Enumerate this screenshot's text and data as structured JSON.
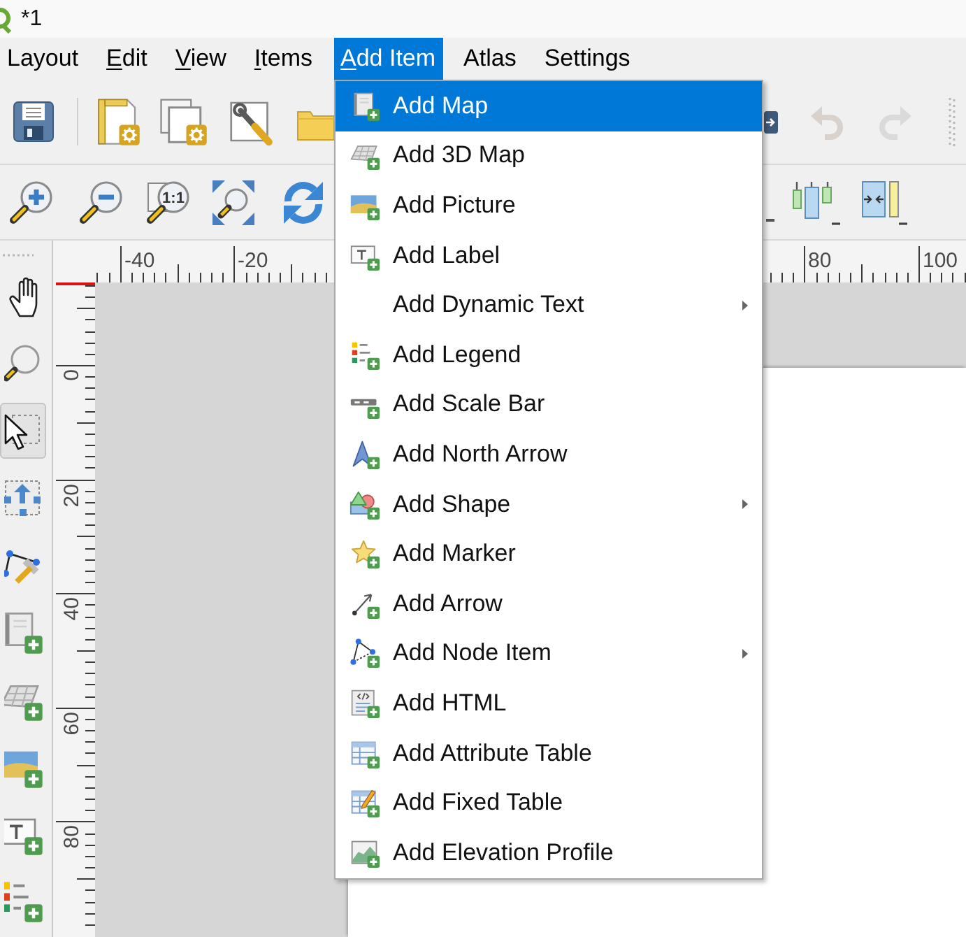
{
  "window": {
    "title": "*1"
  },
  "menu_bar": [
    {
      "label": "Layout",
      "selected": false,
      "mnemonic_underlined": false
    },
    {
      "label": "Edit",
      "selected": false,
      "mnemonic_underlined": true
    },
    {
      "label": "View",
      "selected": false,
      "mnemonic_underlined": true
    },
    {
      "label": "Items",
      "selected": false,
      "mnemonic_underlined": true
    },
    {
      "label": "Add Item",
      "selected": true,
      "mnemonic_underlined": true
    },
    {
      "label": "Atlas",
      "selected": false,
      "mnemonic_underlined": false
    },
    {
      "label": "Settings",
      "selected": false,
      "mnemonic_underlined": false
    }
  ],
  "toolbar": {
    "zoom_actual_size": {
      "label": "1:1"
    },
    "undo": {
      "disabled": true
    },
    "redo": {
      "disabled": true
    }
  },
  "tool_panel": {
    "tools": [
      {
        "selected": false
      },
      {
        "selected": false
      },
      {
        "selected": true
      },
      {
        "selected": false
      },
      {
        "selected": false
      },
      {
        "selected": false
      },
      {
        "selected": false
      },
      {
        "selected": false
      },
      {
        "selected": false
      },
      {
        "selected": false
      }
    ]
  },
  "rulers": {
    "horizontal": [
      "-40",
      "-20",
      "80",
      "100"
    ],
    "vertical": [
      "0",
      "20",
      "40",
      "60",
      "80"
    ]
  },
  "add_item_menu": [
    {
      "label": "Add Map",
      "selected": true,
      "submenu": false
    },
    {
      "label": "Add 3D Map",
      "selected": false,
      "submenu": false
    },
    {
      "label": "Add Picture",
      "selected": false,
      "submenu": false
    },
    {
      "label": "Add Label",
      "selected": false,
      "submenu": false
    },
    {
      "label": "Add Dynamic Text",
      "selected": false,
      "submenu": true
    },
    {
      "label": "Add Legend",
      "selected": false,
      "submenu": false
    },
    {
      "label": "Add Scale Bar",
      "selected": false,
      "submenu": false
    },
    {
      "label": "Add North Arrow",
      "selected": false,
      "submenu": false
    },
    {
      "label": "Add Shape",
      "selected": false,
      "submenu": true
    },
    {
      "label": "Add Marker",
      "selected": false,
      "submenu": false
    },
    {
      "label": "Add Arrow",
      "selected": false,
      "submenu": false
    },
    {
      "label": "Add Node Item",
      "selected": false,
      "submenu": true
    },
    {
      "label": "Add HTML",
      "selected": false,
      "submenu": false
    },
    {
      "label": "Add Attribute Table",
      "selected": false,
      "submenu": false
    },
    {
      "label": "Add Fixed Table",
      "selected": false,
      "submenu": false
    },
    {
      "label": "Add Elevation Profile",
      "selected": false,
      "submenu": false
    }
  ]
}
